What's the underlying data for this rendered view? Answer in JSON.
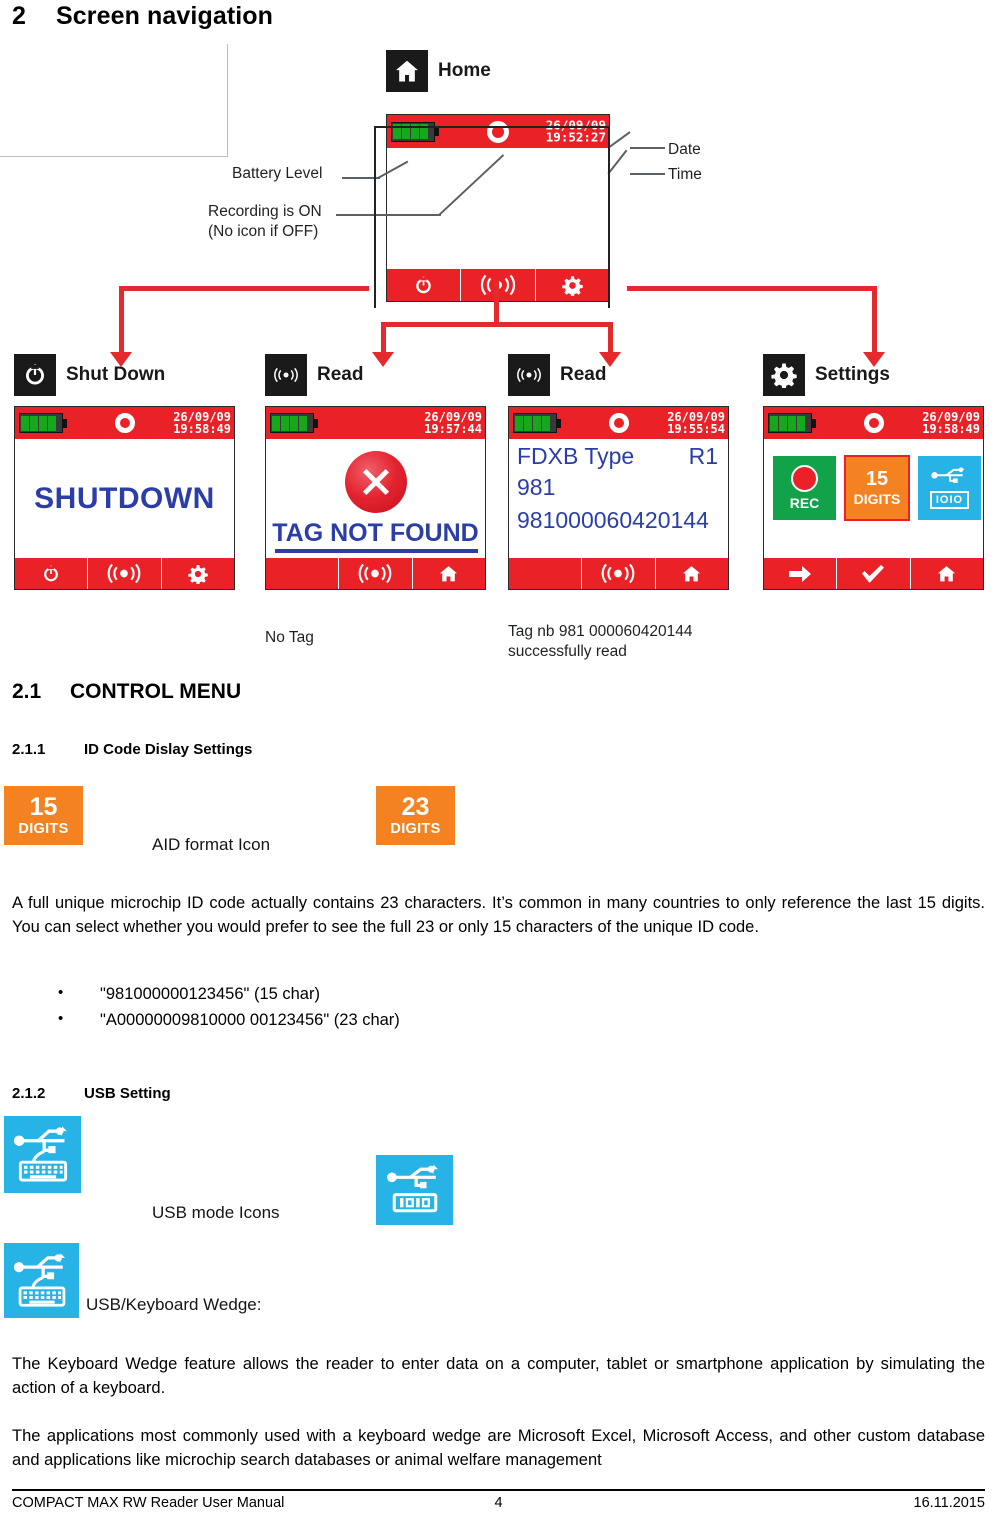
{
  "document": {
    "section_number": "2",
    "section_title": "Screen navigation"
  },
  "diagram": {
    "home": {
      "icon_name": "home-icon",
      "label": "Home",
      "status": {
        "date": "26/09/09",
        "time": "19:52:27"
      },
      "annotations": {
        "battery": "Battery Level",
        "recording_line1": "Recording is ON",
        "recording_line2": "(No icon if OFF)",
        "date": "Date",
        "time": "Time"
      },
      "nav": [
        "power-icon",
        "read-wave-icon",
        "gear-icon"
      ]
    },
    "branches": [
      {
        "icon_name": "power-icon",
        "label": "Shut Down",
        "status": {
          "date": "26/09/09",
          "time": "19:58:49"
        },
        "body_text": "SHUTDOWN",
        "nav": [
          "power-icon",
          "read-wave-icon",
          "gear-icon"
        ],
        "caption": ""
      },
      {
        "icon_name": "read-wave-icon",
        "label": "Read",
        "status": {
          "date": "26/09/09",
          "time": "19:57:44"
        },
        "body_text": "TAG NOT FOUND",
        "nav": [
          "blank",
          "read-wave-icon",
          "home-icon"
        ],
        "caption": "No Tag"
      },
      {
        "icon_name": "read-wave-icon",
        "label": "Read",
        "status": {
          "date": "26/09/09",
          "time": "19:55:54"
        },
        "tag_lines": [
          "FDXB Type",
          "R1",
          "981",
          "981000060420144"
        ],
        "nav": [
          "blank",
          "read-wave-icon",
          "home-icon"
        ],
        "caption_line1": "Tag nb 981 000060420144",
        "caption_line2": "successfully read"
      },
      {
        "icon_name": "gear-icon",
        "label": "Settings",
        "status": {
          "date": "26/09/09",
          "time": "19:58:49"
        },
        "tiles": [
          {
            "name": "rec-tile",
            "label": "REC"
          },
          {
            "name": "digits-tile",
            "number": "15",
            "label": "DIGITS"
          },
          {
            "name": "usb-serial-tile",
            "label": "IOIO"
          }
        ],
        "nav": [
          "arrow-right-icon",
          "check-icon",
          "home-icon"
        ],
        "caption": ""
      }
    ]
  },
  "sections": {
    "control_menu": {
      "number": "2.1",
      "title": "CONTROL MENU"
    },
    "id_code": {
      "number": "2.1.1",
      "title": "ID Code Dislay Settings",
      "icon_left": {
        "number": "15",
        "label": "DIGITS"
      },
      "icon_right": {
        "number": "23",
        "label": "DIGITS"
      },
      "icon_caption": "AID format Icon",
      "paragraph": "A full unique microchip ID code actually contains 23 characters. It’s common in many countries to only reference the last 15 digits. You can select whether you would prefer to see the full 23 or only 15 characters of the unique ID code.",
      "bullets": [
        "\"981000000123456\" (15 char)",
        "\"A00000009810000 00123456\" (23 char)"
      ]
    },
    "usb_setting": {
      "number": "2.1.2",
      "title": "USB Setting",
      "icon_left_name": "usb-keyboard-icon",
      "icon_right_name": "usb-serial-icon",
      "icon_caption": "USB mode Icons",
      "wedge_icon_name": "usb-keyboard-icon",
      "wedge_label": "USB/Keyboard Wedge:",
      "paragraph_1": "The Keyboard Wedge feature allows the reader to enter data on a computer, tablet or smartphone application by simulating the action of a keyboard.",
      "paragraph_2": "The applications most commonly used with a keyboard wedge are Microsoft Excel, Microsoft Access, and other custom database and applications like microchip search databases or animal welfare management"
    }
  },
  "footer": {
    "left": "COMPACT MAX RW Reader User Manual",
    "center": "4",
    "right": "16.11.2015"
  },
  "colors": {
    "red": "#ea2227",
    "arrow_red": "#e52a2e",
    "orange": "#f58220",
    "cyan": "#27b3e5",
    "green": "#12a24a",
    "blue_text": "#2b3ea8",
    "battery_green": "#16a81c"
  }
}
